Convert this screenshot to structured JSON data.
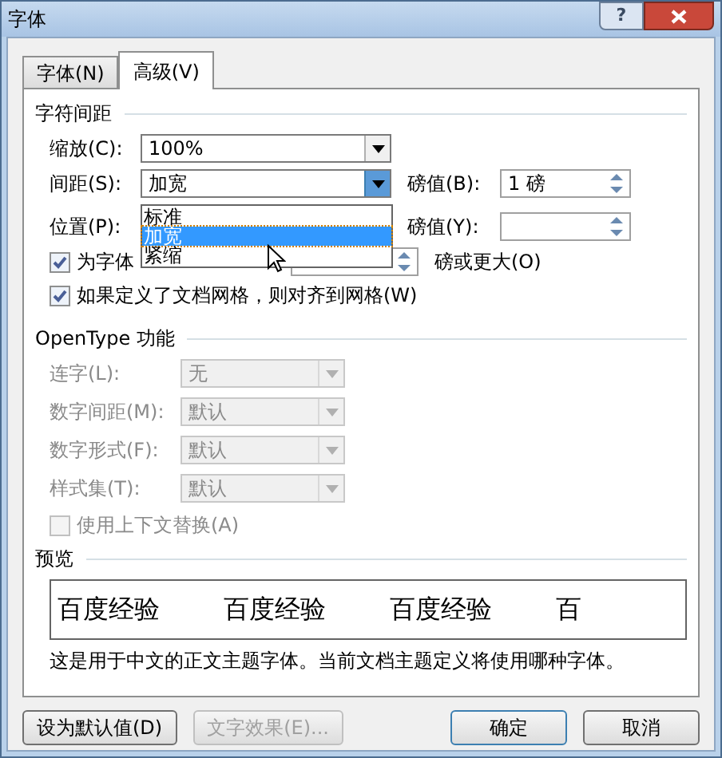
{
  "window": {
    "title": "字体",
    "help": "?"
  },
  "tabs": [
    {
      "label": "字体(N)",
      "selected": false
    },
    {
      "label": "高级(V)",
      "selected": true
    }
  ],
  "character_spacing": {
    "title": "字符间距",
    "scale": {
      "label": "缩放(C):",
      "value": "100%"
    },
    "spacing": {
      "label": "间距(S):",
      "value": "加宽",
      "open": true
    },
    "spacing_by": {
      "label": "磅值(B):",
      "value": "1 磅"
    },
    "position": {
      "label": "位置(P):"
    },
    "position_by": {
      "label": "磅值(Y):"
    },
    "dropdown_options": [
      {
        "label": "标准",
        "selected": false
      },
      {
        "label": "加宽",
        "selected": true
      },
      {
        "label": "紧缩",
        "selected": false
      }
    ],
    "kerning": {
      "label": "为字体",
      "checked": true,
      "suffix": "磅或更大(O)"
    },
    "snap_to_grid": {
      "label": "如果定义了文档网格，则对齐到网格(W)",
      "checked": true
    }
  },
  "opentype": {
    "title": "OpenType 功能",
    "rows": [
      {
        "label": "连字(L):",
        "value": "无",
        "disabled": true
      },
      {
        "label": "数字间距(M):",
        "value": "默认",
        "disabled": true
      },
      {
        "label": "数字形式(F):",
        "value": "默认",
        "disabled": true
      },
      {
        "label": "样式集(T):",
        "value": "默认",
        "disabled": true
      }
    ],
    "contextual": {
      "label": "使用上下文替换(A)",
      "checked": false,
      "disabled": true
    }
  },
  "preview": {
    "title": "预览",
    "samples": [
      "百度经验",
      "百度经验",
      "百度经验",
      "百"
    ],
    "description": "这是用于中文的正文主题字体。当前文档主题定义将使用哪种字体。"
  },
  "buttons": [
    {
      "label": "设为默认值(D)",
      "disabled": false,
      "default": false
    },
    {
      "label": "文字效果(E)...",
      "disabled": true,
      "default": false
    },
    {
      "label": "确定",
      "disabled": false,
      "default": true
    },
    {
      "label": "取消",
      "disabled": false,
      "default": false
    }
  ]
}
